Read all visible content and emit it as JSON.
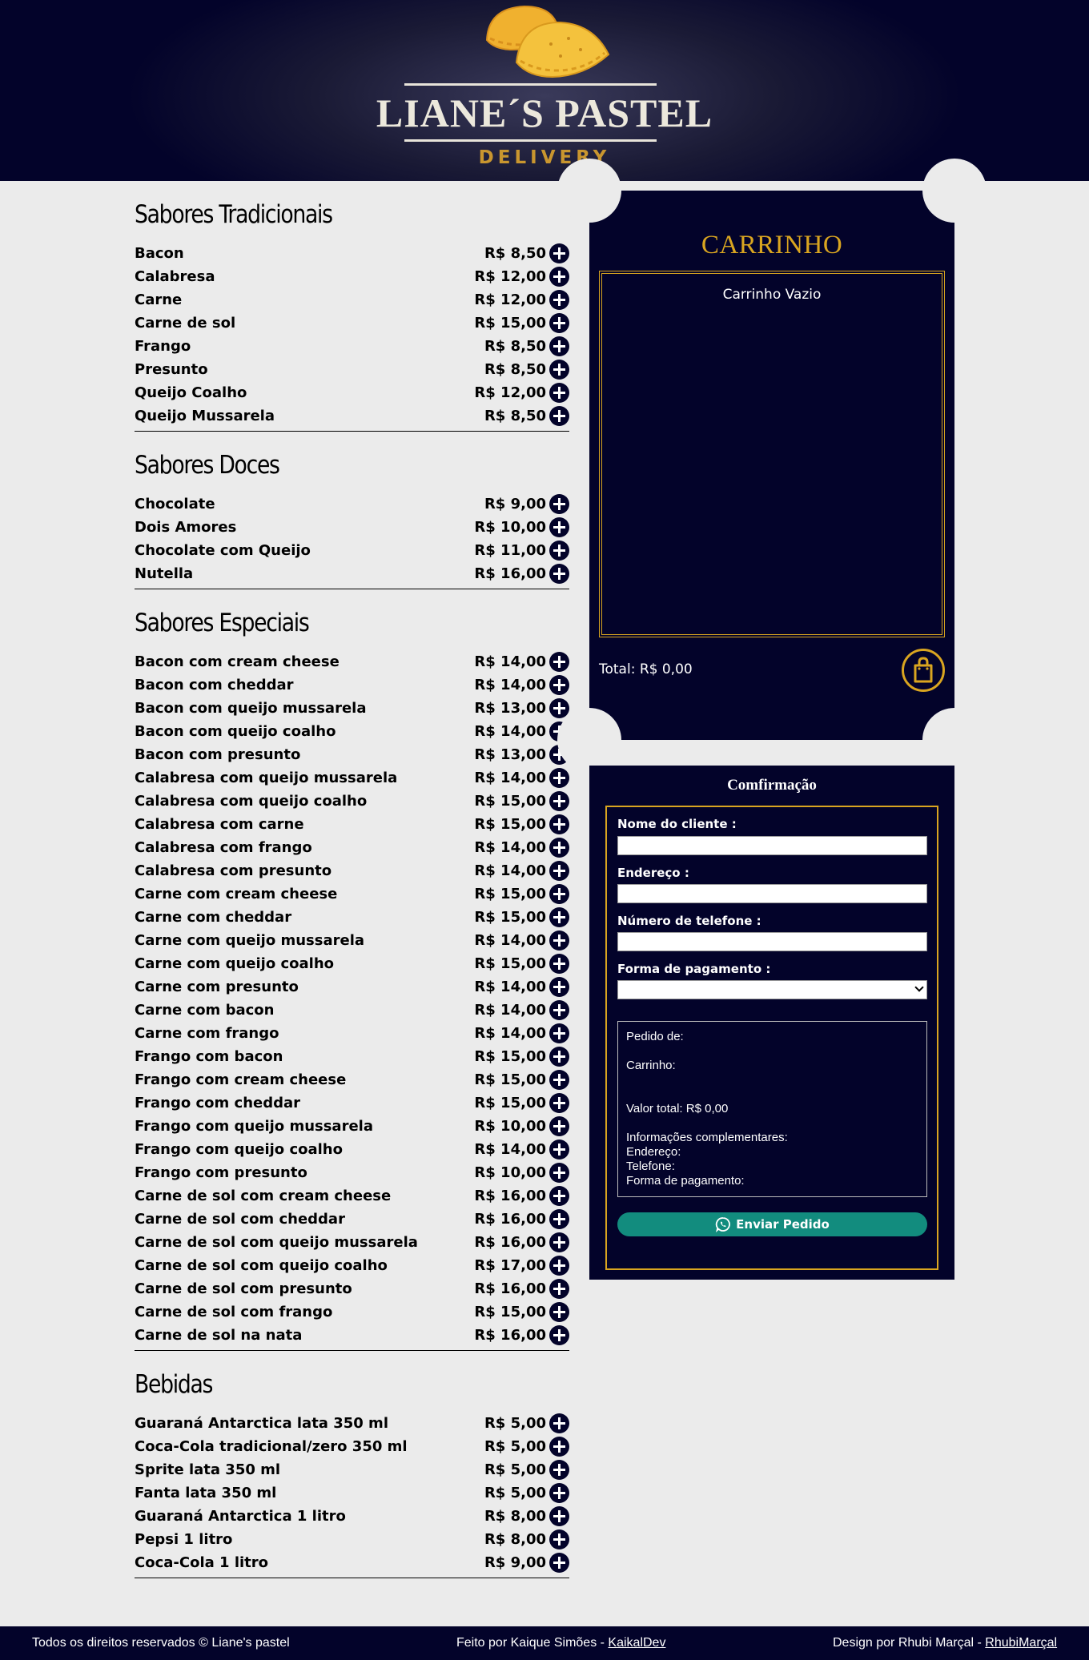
{
  "brand": {
    "title": "LIANE´S PASTEL",
    "subtitle": "DELIVERY"
  },
  "sections": [
    {
      "title": "Sabores Tradicionais",
      "items": [
        {
          "name": "Bacon",
          "price": "R$ 8,50"
        },
        {
          "name": "Calabresa",
          "price": "R$ 12,00"
        },
        {
          "name": "Carne",
          "price": "R$ 12,00"
        },
        {
          "name": "Carne de sol",
          "price": "R$ 15,00"
        },
        {
          "name": "Frango",
          "price": "R$ 8,50"
        },
        {
          "name": "Presunto",
          "price": "R$ 8,50"
        },
        {
          "name": "Queijo Coalho",
          "price": "R$ 12,00"
        },
        {
          "name": "Queijo Mussarela",
          "price": "R$ 8,50"
        }
      ]
    },
    {
      "title": "Sabores Doces",
      "items": [
        {
          "name": "Chocolate",
          "price": "R$ 9,00"
        },
        {
          "name": "Dois Amores",
          "price": "R$ 10,00"
        },
        {
          "name": "Chocolate com Queijo",
          "price": "R$ 11,00"
        },
        {
          "name": "Nutella",
          "price": "R$ 16,00"
        }
      ]
    },
    {
      "title": "Sabores Especiais",
      "items": [
        {
          "name": "Bacon com cream cheese",
          "price": "R$ 14,00"
        },
        {
          "name": "Bacon com cheddar",
          "price": "R$ 14,00"
        },
        {
          "name": "Bacon com queijo mussarela",
          "price": "R$ 13,00"
        },
        {
          "name": "Bacon com queijo coalho",
          "price": "R$ 14,00"
        },
        {
          "name": "Bacon com presunto",
          "price": "R$ 13,00"
        },
        {
          "name": "Calabresa com queijo mussarela",
          "price": "R$ 14,00"
        },
        {
          "name": "Calabresa com queijo coalho",
          "price": "R$ 15,00"
        },
        {
          "name": "Calabresa com carne",
          "price": "R$ 15,00"
        },
        {
          "name": "Calabresa com frango",
          "price": "R$ 14,00"
        },
        {
          "name": "Calabresa com presunto",
          "price": "R$ 14,00"
        },
        {
          "name": "Carne com cream cheese",
          "price": "R$ 15,00"
        },
        {
          "name": "Carne com cheddar",
          "price": "R$ 15,00"
        },
        {
          "name": "Carne com queijo mussarela",
          "price": "R$ 14,00"
        },
        {
          "name": "Carne com queijo coalho",
          "price": "R$ 15,00"
        },
        {
          "name": "Carne com presunto",
          "price": "R$ 14,00"
        },
        {
          "name": "Carne com bacon",
          "price": "R$ 14,00"
        },
        {
          "name": "Carne com frango",
          "price": "R$ 14,00"
        },
        {
          "name": "Frango com bacon",
          "price": "R$ 15,00"
        },
        {
          "name": "Frango com cream cheese",
          "price": "R$ 15,00"
        },
        {
          "name": "Frango com cheddar",
          "price": "R$ 15,00"
        },
        {
          "name": "Frango com queijo mussarela",
          "price": "R$ 10,00"
        },
        {
          "name": "Frango com queijo coalho",
          "price": "R$ 14,00"
        },
        {
          "name": "Frango com presunto",
          "price": "R$ 10,00"
        },
        {
          "name": "Carne de sol com cream cheese",
          "price": "R$ 16,00"
        },
        {
          "name": "Carne de sol com cheddar",
          "price": "R$ 16,00"
        },
        {
          "name": "Carne de sol com queijo mussarela",
          "price": "R$ 16,00"
        },
        {
          "name": "Carne de sol com queijo coalho",
          "price": "R$ 17,00"
        },
        {
          "name": "Carne de sol com presunto",
          "price": "R$ 16,00"
        },
        {
          "name": "Carne de sol com frango",
          "price": "R$ 15,00"
        },
        {
          "name": "Carne de sol na nata",
          "price": "R$ 16,00"
        }
      ]
    },
    {
      "title": "Bebidas",
      "items": [
        {
          "name": "Guaraná Antarctica lata 350 ml",
          "price": "R$ 5,00"
        },
        {
          "name": "Coca-Cola tradicional/zero 350 ml",
          "price": "R$ 5,00"
        },
        {
          "name": "Sprite lata 350 ml",
          "price": "R$ 5,00"
        },
        {
          "name": "Fanta lata 350 ml",
          "price": "R$ 5,00"
        },
        {
          "name": "Guaraná Antarctica 1 litro",
          "price": "R$ 8,00"
        },
        {
          "name": "Pepsi 1 litro",
          "price": "R$ 8,00"
        },
        {
          "name": "Coca-Cola 1 litro",
          "price": "R$ 9,00"
        }
      ]
    }
  ],
  "cart": {
    "title": "CARRINHO",
    "empty_text": "Carrinho Vazio",
    "total": "Total: R$ 0,00"
  },
  "confirm": {
    "title": "Comfirmação",
    "name_label": "Nome do cliente :",
    "address_label": "Endereço :",
    "phone_label": "Número de telefone :",
    "payment_label": "Forma de pagamento :",
    "summary": {
      "order_of": "Pedido de:",
      "cart": "Carrinho:",
      "total": "Valor total:   R$ 0,00",
      "info": "Informações complementares:",
      "address": "Endereço:",
      "phone": "Telefone:",
      "payment": "Forma de pagamento:"
    },
    "send_label": "Enviar Pedido"
  },
  "footer": {
    "rights": "Todos os direitos reservados © Liane's pastel",
    "made_by": "Feito por Kaique Simões - ",
    "made_by_link": "KaikalDev",
    "design_by": "Design por Rhubi Marçal - ",
    "design_by_link": "RhubiMarçal"
  },
  "colors": {
    "navy": "#03032a",
    "gold": "#d9a520",
    "whatsapp": "#128c7e",
    "background": "#ebebeb"
  },
  "icons": [
    "pastel-logo",
    "plus-circle-icon",
    "shopping-bag-icon",
    "whatsapp-icon",
    "chevron-down-icon"
  ]
}
